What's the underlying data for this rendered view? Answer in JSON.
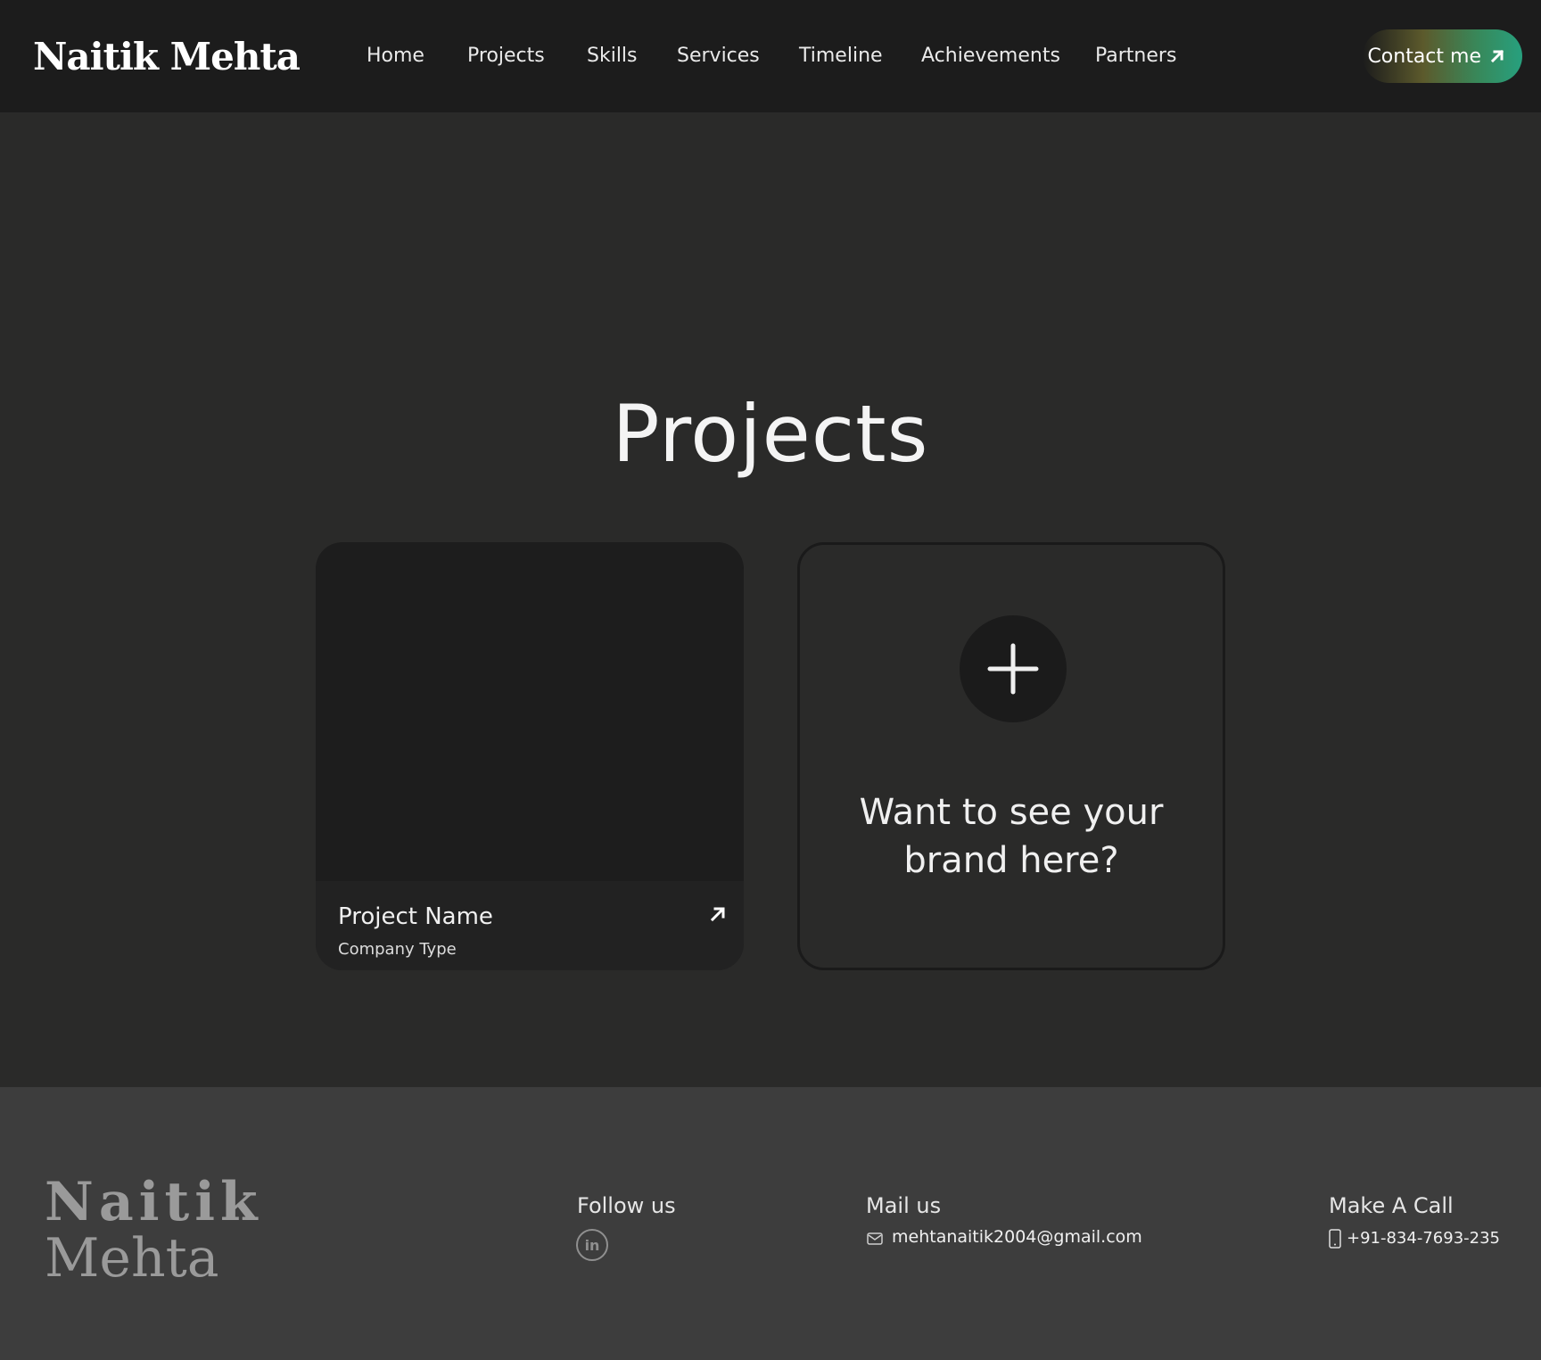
{
  "header": {
    "logo": "Naitik Mehta",
    "nav": [
      "Home",
      "Projects",
      "Skills",
      "Services",
      "Timeline",
      "Achievements",
      "Partners"
    ],
    "contact_label": "Contact me"
  },
  "main": {
    "title": "Projects",
    "project_card": {
      "name": "Project Name",
      "type": "Company Type"
    },
    "cta_card": {
      "line1": "Want to see your",
      "line2": "brand here?"
    }
  },
  "footer": {
    "logo_line1": "Naitik",
    "logo_line2": "Mehta",
    "follow_heading": "Follow us",
    "linkedin_label": "in",
    "mail_heading": "Mail us",
    "email": "mehtanaitik2004@gmail.com",
    "call_heading": "Make A Call",
    "phone": "+91-834-7693-235"
  },
  "colors": {
    "header_bg": "#1c1c1c",
    "page_bg": "#2a2a29",
    "footer_bg": "#3d3d3d",
    "accent_green": "#27a07e",
    "accent_olive": "#5c5a2c"
  },
  "icons": {
    "contact": "arrow-up-right-icon",
    "project": "arrow-up-right-icon",
    "add": "plus-icon",
    "social": "linkedin-icon",
    "mail": "mail-icon",
    "phone": "phone-icon"
  }
}
